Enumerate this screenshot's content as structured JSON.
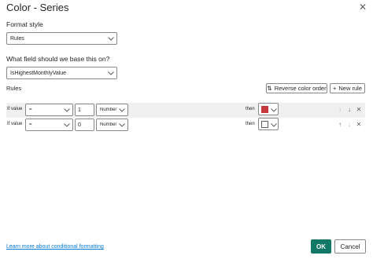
{
  "dialog": {
    "title": "Color - Series",
    "close_icon": "close-icon"
  },
  "format_style": {
    "label": "Format style",
    "value": "Rules"
  },
  "base_field": {
    "label": "What field should we base this on?",
    "value": "IsHighestMonthlyValue"
  },
  "rules": {
    "label": "Rules",
    "reverse_label": "Reverse color order",
    "new_rule_label": "New rule",
    "items": [
      {
        "if_label": "If value",
        "operator": "=",
        "value": "1",
        "type": "Number",
        "then_label": "then",
        "color": "#c4373a"
      },
      {
        "if_label": "If value",
        "operator": "=",
        "value": "0",
        "type": "Number",
        "then_label": "then",
        "color": "#ffffff"
      }
    ]
  },
  "footer": {
    "link": "Learn more about conditional formatting",
    "ok_label": "OK",
    "cancel_label": "Cancel"
  },
  "colors": {
    "accent": "#117865",
    "link": "#0078d4",
    "row_highlight": "#f0f0f0"
  }
}
